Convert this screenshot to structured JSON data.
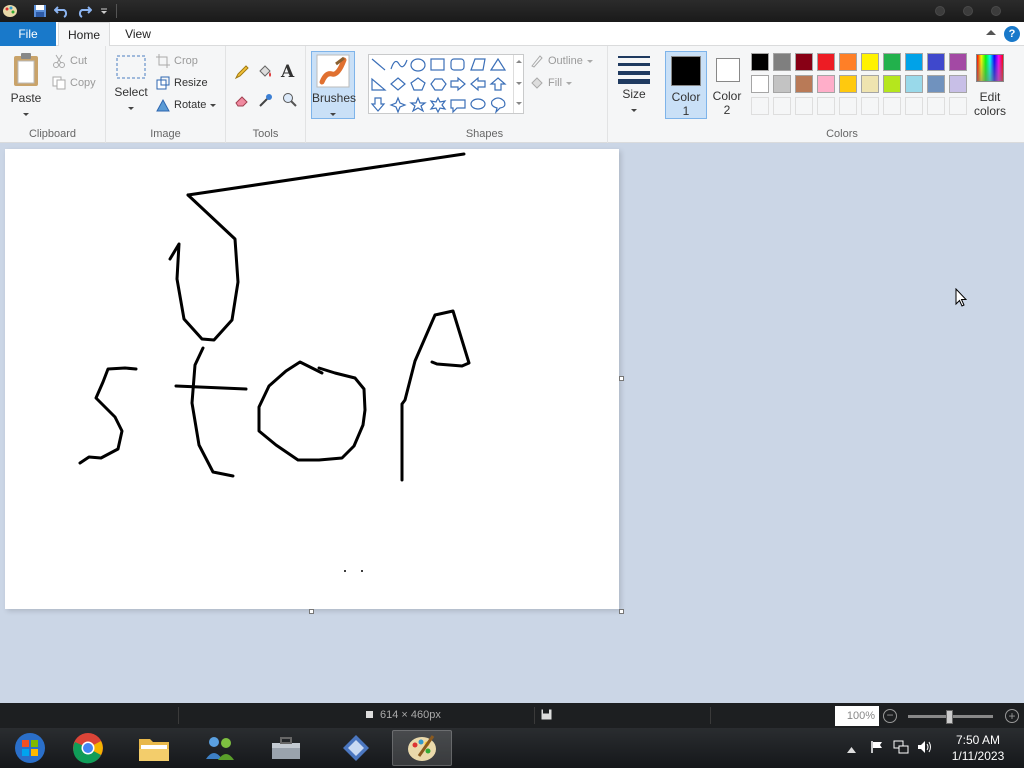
{
  "ribbon_tabs": {
    "file": "File",
    "home": "Home",
    "view": "View"
  },
  "clipboard": {
    "paste": "Paste",
    "cut": "Cut",
    "copy": "Copy",
    "label": "Clipboard"
  },
  "image": {
    "select": "Select",
    "crop": "Crop",
    "resize": "Resize",
    "rotate": "Rotate",
    "label": "Image"
  },
  "tools": {
    "label": "Tools"
  },
  "brushes": {
    "label": "Brushes"
  },
  "shapes": {
    "outline": "Outline",
    "fill": "Fill",
    "label": "Shapes"
  },
  "size": {
    "label": "Size"
  },
  "colors": {
    "color1": "Color 1",
    "color1_line1": "Color",
    "color1_line2": "1",
    "color2_line1": "Color",
    "color2_line2": "2",
    "edit_line1": "Edit",
    "edit_line2": "colors",
    "label": "Colors",
    "color1_value": "#000000",
    "color2_value": "#ffffff",
    "palette_row1": [
      "#000000",
      "#7f7f7f",
      "#880015",
      "#ed1c24",
      "#ff7f27",
      "#fff200",
      "#22b14c",
      "#00a2e8",
      "#3f48cc",
      "#a349a4"
    ],
    "palette_row2": [
      "#ffffff",
      "#c3c3c3",
      "#b97a57",
      "#ffaec9",
      "#ffc90e",
      "#efe4b0",
      "#b5e61d",
      "#99d9ea",
      "#7092be",
      "#c8bfe7"
    ]
  },
  "status": {
    "dimensions": "614 × 460px",
    "zoom": "100%"
  },
  "clock": {
    "time": "7:50 AM",
    "date": "1/11/2023"
  }
}
